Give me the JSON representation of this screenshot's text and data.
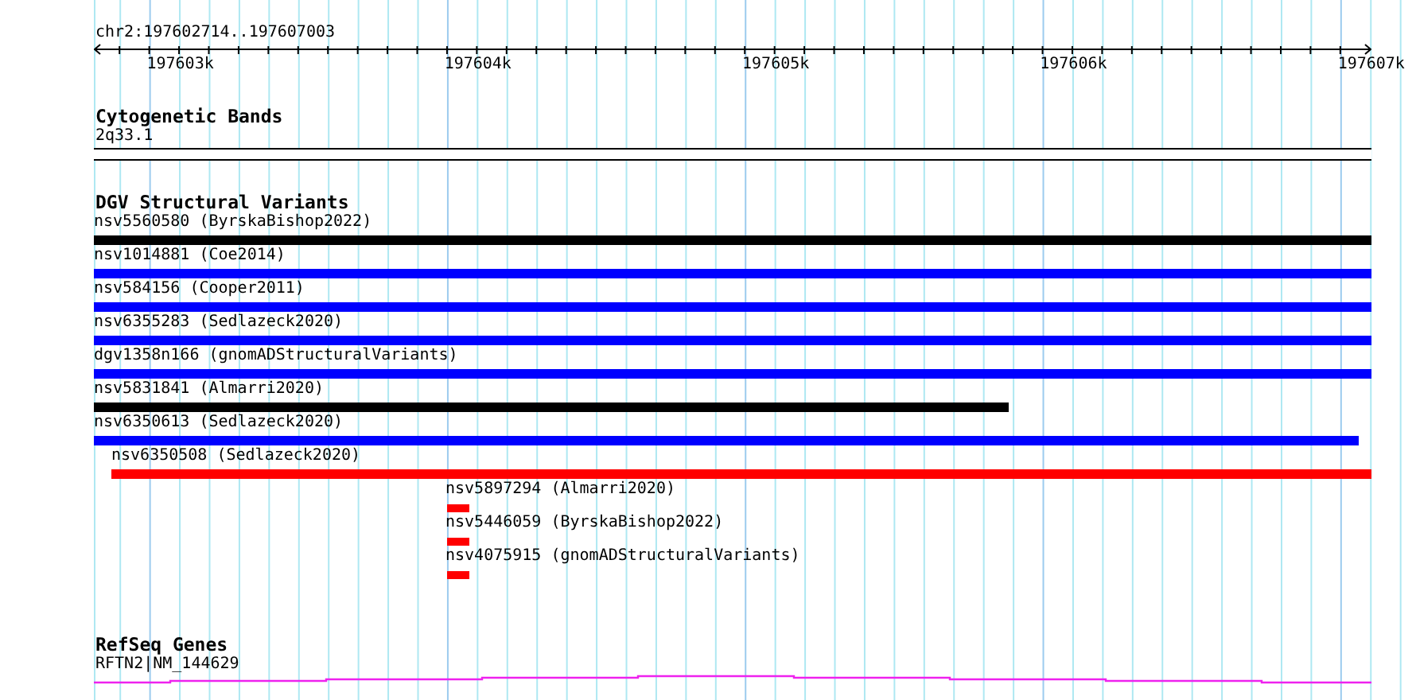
{
  "position": "chr2:197602714..197607003",
  "ruler_ticks": [
    "197603k",
    "197604k",
    "197605k",
    "197606k",
    "197607k"
  ],
  "tracks": [
    {
      "kind": "bands",
      "title": "Cytogenetic Bands",
      "features": [
        {
          "label": "2q33.1"
        }
      ]
    },
    {
      "kind": "variants",
      "title": "DGV Structural Variants",
      "features": [
        {
          "label": "nsv5560580 (ByrskaBishop2022)",
          "color": "#000000"
        },
        {
          "label": "nsv1014881 (Coe2014)",
          "color": "#0000ff"
        },
        {
          "label": "nsv584156 (Cooper2011)",
          "color": "#0000ff"
        },
        {
          "label": "nsv6355283 (Sedlazeck2020)",
          "color": "#0000ff"
        },
        {
          "label": "dgv1358n166 (gnomADStructuralVariants)",
          "color": "#0000ff"
        },
        {
          "label": "nsv5831841 (Almarri2020)",
          "color": "#000000"
        },
        {
          "label": "nsv6350613 (Sedlazeck2020)",
          "color": "#0000ff"
        },
        {
          "label": "nsv6350508 (Sedlazeck2020)",
          "color": "#ff0000"
        },
        {
          "label": "nsv5897294 (Almarri2020)",
          "color": "#ff0000"
        },
        {
          "label": "nsv5446059 (ByrskaBishop2022)",
          "color": "#ff0000"
        },
        {
          "label": "nsv4075915 (gnomADStructuralVariants)",
          "color": "#ff0000"
        }
      ]
    },
    {
      "kind": "genes",
      "title": "RefSeq Genes",
      "features": [
        {
          "label": "RFTN2|NM_144629"
        }
      ]
    }
  ]
}
